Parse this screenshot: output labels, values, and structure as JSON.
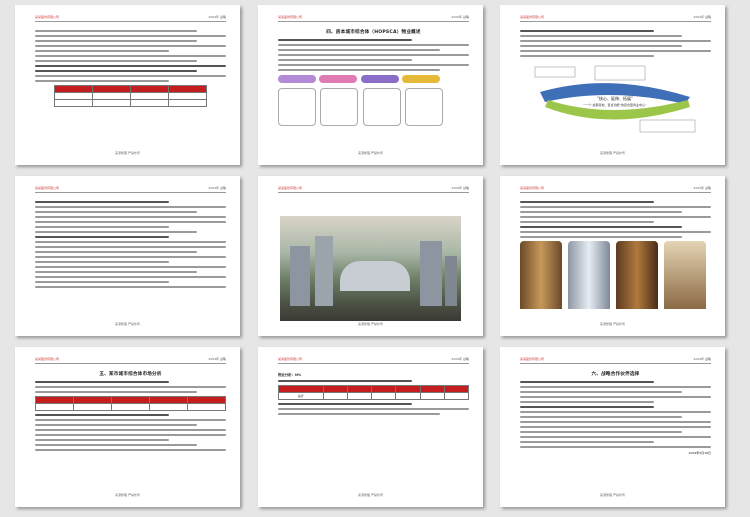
{
  "pages": [
    {
      "footer": "来源整理    严禁外传"
    },
    {
      "footer": "来源整理    严禁外传",
      "title": "四、房本城市综合体（HOPSCA）物业概述"
    },
    {
      "footer": "来源整理    严禁外传",
      "diagram_center": "“核心、延伸、拓展”",
      "diagram_mid": "“一个“总部基地、复合功能”的复合型商业中心”"
    },
    {
      "footer": "来源整理    严禁外传"
    },
    {
      "footer": "来源整理    严禁外传"
    },
    {
      "footer": "来源整理    严禁外传"
    },
    {
      "footer": "来源整理    严禁外传",
      "title": "五、某市城市综合体市场分析"
    },
    {
      "footer": "来源整理    严禁外传",
      "label": "物业分析：N%",
      "table_row_label": "总计"
    },
    {
      "footer": "来源整理    严禁外传",
      "title": "六、战略合作伙伴选择",
      "sign": "2009年5月18日"
    }
  ],
  "header_logo_text": "某某股份有限公司",
  "header_right_text": "2009年 战略",
  "colors": {
    "accent_red": "#c41e1e",
    "pill_purple": "#b28ad6",
    "pill_pink": "#e07ab5",
    "pill_violet": "#8a6cc9",
    "pill_gold": "#e6b838",
    "arrow_green": "#9cc64a",
    "arrow_blue": "#3f6fb6"
  }
}
